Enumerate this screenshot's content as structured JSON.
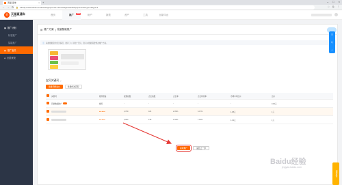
{
  "browser": {
    "tab_title": "天猫直通车",
    "tab_close": "×",
    "new_tab": "+",
    "window_controls": [
      "–",
      "□",
      "×"
    ],
    "nav": [
      "←",
      "→",
      "⟳"
    ],
    "url": "subway.simba.taobao.com/#!/manage/promote-mini/manage/wizard/step?promotionType=4&type=4"
  },
  "header": {
    "logo_mark": "天",
    "logo_text": "天猫直通车",
    "logo_sub": "SUBWAY",
    "nav": [
      {
        "label": "首页",
        "active": false
      },
      {
        "label": "推广",
        "active": true,
        "badge": "NEW"
      },
      {
        "label": "帐户",
        "active": false
      },
      {
        "label": "报表",
        "active": false
      },
      {
        "label": "资产",
        "active": false
      },
      {
        "label": "工具",
        "active": false
      },
      {
        "label": "创新平台",
        "active": false
      }
    ]
  },
  "sidebar": {
    "items": [
      {
        "label": "推广计划",
        "type": "group"
      },
      {
        "label": "标准推广",
        "type": "sub"
      },
      {
        "label": "智能推广",
        "type": "sub"
      },
      {
        "label": "推广宝贝",
        "type": "active"
      },
      {
        "label": "创意优化",
        "type": "item"
      }
    ]
  },
  "main": {
    "breadcrumb": [
      "推广方案",
      "批量智能推广"
    ],
    "notice": "系统根据您的宝贝情况，推荐了以下推广宝贝，您可以根据需要修改推广方案。",
    "section_title": "宝贝关键词",
    "buttons": [
      "批量调整出价",
      "批量修改匹配"
    ],
    "table": {
      "headers": [
        "",
        "关键词",
        "推荐理由",
        "展现指数",
        "点击指数",
        "点击率",
        "点击转化率",
        "市场平均出价",
        "出价"
      ],
      "rows": [
        {
          "checked": true,
          "kw": "风暴数据推广",
          "reason": "推荐",
          "impr": "-",
          "clicks": "-",
          "ctr": "-",
          "cvr": "-",
          "avg": "-",
          "bid": "0.90元",
          "highlight": false,
          "toggle": true
        },
        {
          "checked": true,
          "kw": "",
          "reason": "●●●●●",
          "impr": "2,799",
          "clicks": "181",
          "ctr": "2.39%",
          "cvr": "6.17%",
          "avg": "1.68元",
          "bid": "1元",
          "highlight": true,
          "toggle": false
        },
        {
          "checked": true,
          "kw": "",
          "reason": "●●●●●",
          "impr": "3,063",
          "clicks": "136",
          "ctr": "4.44%",
          "cvr": "7.13%",
          "avg": "1.32元",
          "bid": "1元",
          "highlight": false,
          "toggle": false
        }
      ]
    },
    "primary_button": "完成推广",
    "secondary_button": "返回上一步"
  },
  "float": {
    "tool_icons": [
      "☰",
      "⎘",
      "⌂"
    ],
    "orange_label": "问题反馈"
  },
  "watermark": {
    "main": "Baidu经验",
    "sub": "jingyan.baidu.com"
  }
}
